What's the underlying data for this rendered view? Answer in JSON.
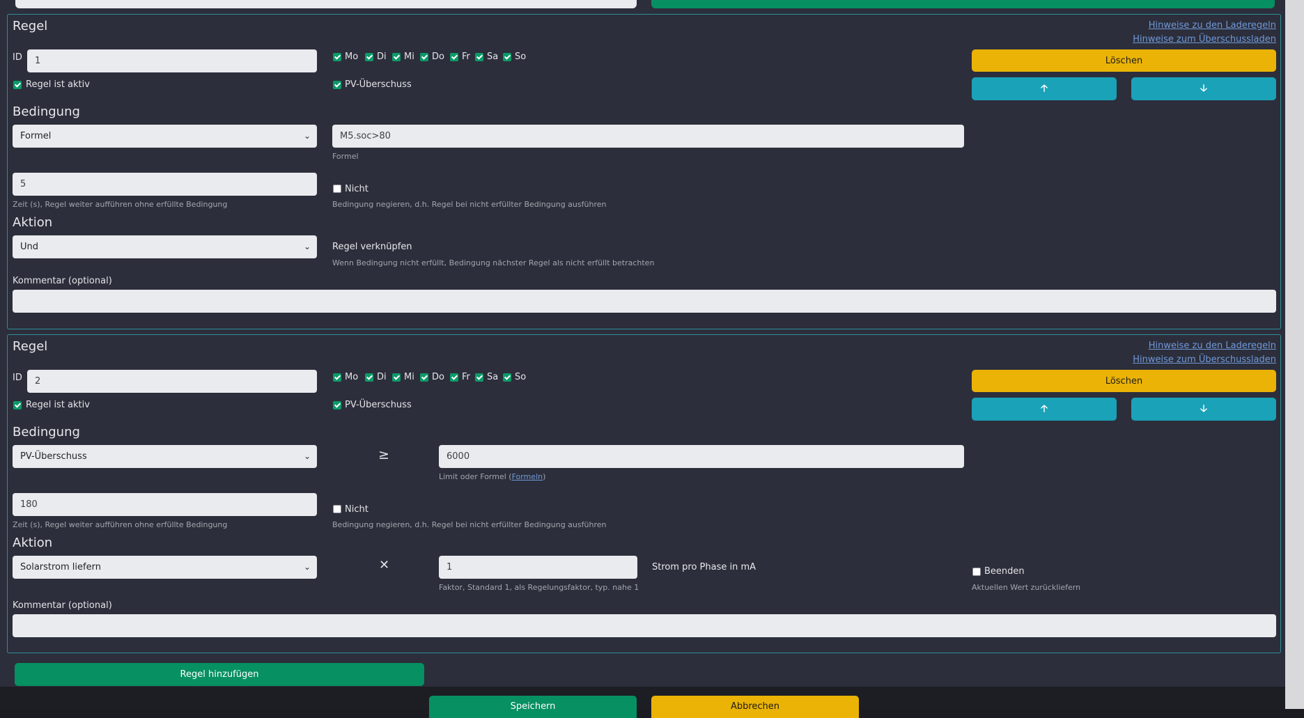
{
  "hints": {
    "laderegeln": "Hinweise zu den Laderegeln",
    "ueberschuss": "Hinweise zum Überschussladen"
  },
  "days": [
    "Mo",
    "Di",
    "Mi",
    "Do",
    "Fr",
    "Sa",
    "So"
  ],
  "labels": {
    "rule_title": "Regel",
    "id": "ID",
    "rule_active": "Regel ist aktiv",
    "pv_surplus": "PV-Überschuss",
    "condition": "Bedingung",
    "action": "Aktion",
    "delete": "Löschen",
    "arrow_up": "🡡",
    "arrow_down": "🡣",
    "not": "Nicht",
    "not_help": "Bedingung negieren, d.h. Regel bei nicht erfüllter Bedingung ausführen",
    "time_help": "Zeit (s), Regel weiter aufführen ohne erfüllte Bedingung",
    "comment": "Kommentar (optional)"
  },
  "rule1": {
    "id_value": "1",
    "condition_type": "Formel",
    "formula_value": "M5.soc>80",
    "formula_help": "Formel",
    "time_value": "5",
    "action_type": "Und",
    "link_label": "Regel verknüpfen",
    "link_help": "Wenn Bedingung nicht erfüllt, Bedingung nächster Regel als nicht erfüllt betrachten",
    "comment_value": ""
  },
  "rule2": {
    "id_value": "2",
    "condition_type": "PV-Überschuss",
    "operator": "≥",
    "limit_value": "6000",
    "limit_help_prefix": "Limit oder Formel (",
    "limit_help_link": "Formeln",
    "limit_help_suffix": ")",
    "time_value": "180",
    "action_type": "Solarstrom liefern",
    "multiply": "✕",
    "factor_value": "1",
    "factor_help": "Faktor, Standard 1, als Regelungsfaktor, typ. nahe 1",
    "unit_label": "Strom pro Phase in mA",
    "finish_label": "Beenden",
    "finish_help": "Aktuellen Wert zurückliefern",
    "comment_value": ""
  },
  "buttons": {
    "add_rule": "Regel hinzufügen",
    "save": "Speichern",
    "cancel": "Abbrechen"
  },
  "colors": {
    "green": "#079061",
    "yellow": "#eab306",
    "teal": "#1aa2b8",
    "card_border": "#2f8f98",
    "background": "#2c2e3b"
  }
}
